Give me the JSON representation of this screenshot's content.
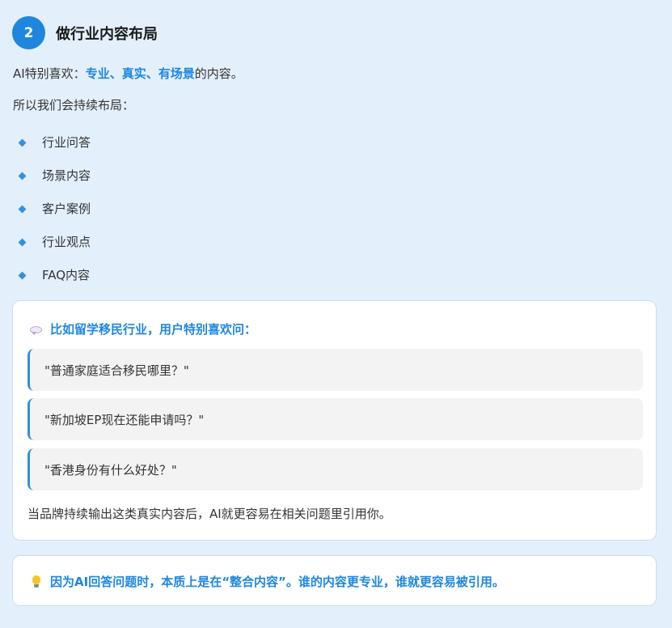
{
  "header": {
    "number": "2",
    "title": "做行业内容布局"
  },
  "intro": {
    "prefix": "AI特别喜欢：",
    "highlight": "专业、真实、有场景",
    "suffix": "的内容。"
  },
  "lead": "所以我们会持续布局：",
  "list_items": [
    "行业问答",
    "场景内容",
    "客户案例",
    "行业观点",
    "FAQ内容"
  ],
  "example_card": {
    "icon": "speech-bubble-icon",
    "heading": "比如留学移民行业，用户特别喜欢问：",
    "quotes": [
      "\"普通家庭适合移民哪里？\"",
      "\"新加坡EP现在还能申请吗？\"",
      "\"香港身份有什么好处？\""
    ],
    "footer": "当品牌持续输出这类真实内容后，AI就更容易在相关问题里引用你。"
  },
  "insight_card": {
    "icon": "lightbulb-icon",
    "text": "因为AI回答问题时，本质上是在“整合内容”。谁的内容更专业，谁就更容易被引用。"
  },
  "colors": {
    "background": "#e3f0fc",
    "accent": "#1f86e0",
    "quote_bar": "#2f8ee6",
    "quote_bg": "#f3f3f3"
  }
}
